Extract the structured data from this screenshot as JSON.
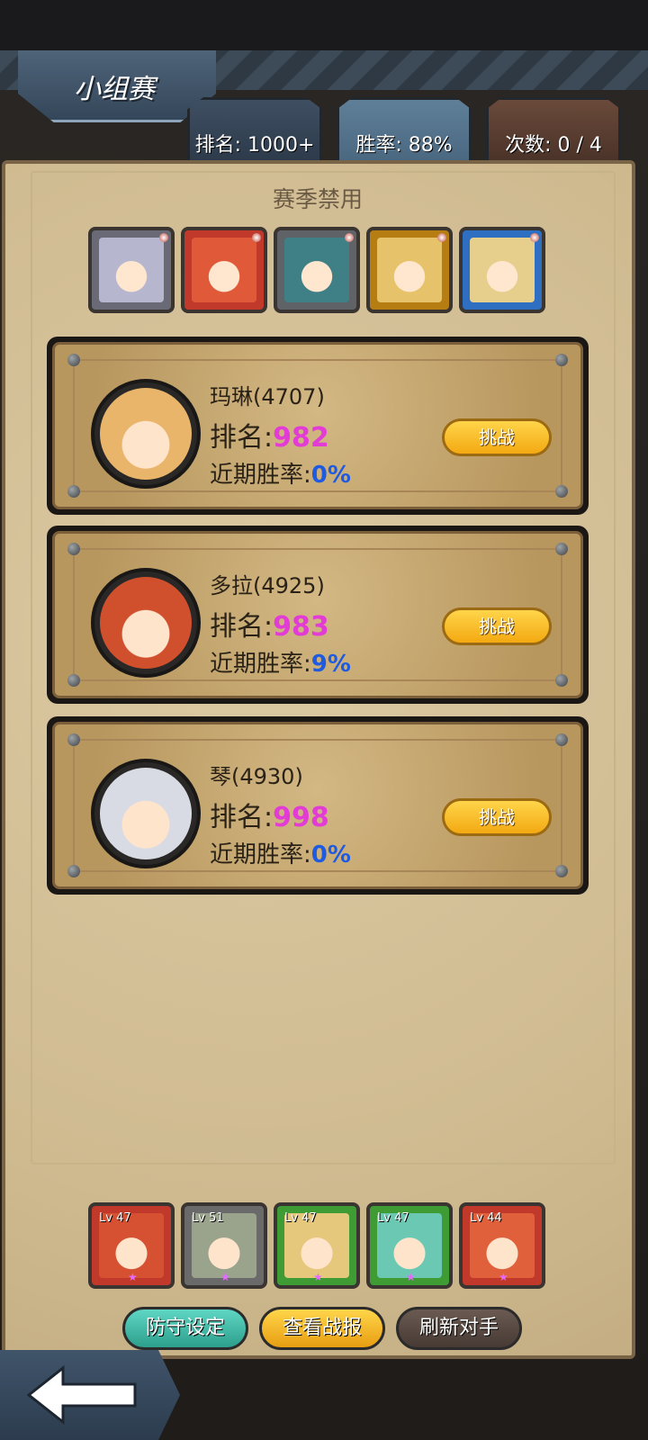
{
  "screen": {
    "title": "小组赛",
    "stats": {
      "rank": "排名: 1000+",
      "win_rate": "胜率: 88%",
      "attempts": "次数: 0 / 4"
    }
  },
  "season_ban": {
    "title": "赛季禁用",
    "heroes": [
      {
        "name": "banned-hero-1",
        "frame": "#6a6a76",
        "tint": "#b7b6cf"
      },
      {
        "name": "banned-hero-2",
        "frame": "#c0392b",
        "tint": "#e05a3a"
      },
      {
        "name": "banned-hero-3",
        "frame": "#5f6266",
        "tint": "#3f7f86"
      },
      {
        "name": "banned-hero-4",
        "frame": "#b57d12",
        "tint": "#e6c36a"
      },
      {
        "name": "banned-hero-5",
        "frame": "#2e6fc2",
        "tint": "#e6cf8c"
      }
    ]
  },
  "opponents": [
    {
      "name": "玛琳(4707)",
      "rank_label": "排名:",
      "rank": "982",
      "win_label": "近期胜率:",
      "win_rate": "0%",
      "challenge": "挑战",
      "tint": "#e8b56a"
    },
    {
      "name": "多拉(4925)",
      "rank_label": "排名:",
      "rank": "983",
      "win_label": "近期胜率:",
      "win_rate": "9%",
      "challenge": "挑战",
      "tint": "#d0502e"
    },
    {
      "name": "琴(4930)",
      "rank_label": "排名:",
      "rank": "998",
      "win_label": "近期胜率:",
      "win_rate": "0%",
      "challenge": "挑战",
      "tint": "#d9dbe4"
    }
  ],
  "team": [
    {
      "level": "Lv 47",
      "frame": "#c0392b",
      "tint": "#d65032"
    },
    {
      "level": "Lv 51",
      "frame": "#6a6a6a",
      "tint": "#9aa38c"
    },
    {
      "level": "Lv 47",
      "frame": "#3f9c34",
      "tint": "#e6c87c"
    },
    {
      "level": "Lv 47",
      "frame": "#3f9c34",
      "tint": "#6bc9b3"
    },
    {
      "level": "Lv 44",
      "frame": "#c0392b",
      "tint": "#e0603c"
    }
  ],
  "buttons": {
    "defense": "防守设定",
    "report": "查看战报",
    "refresh": "刷新对手"
  },
  "icons": {
    "back": "back-arrow-icon"
  }
}
